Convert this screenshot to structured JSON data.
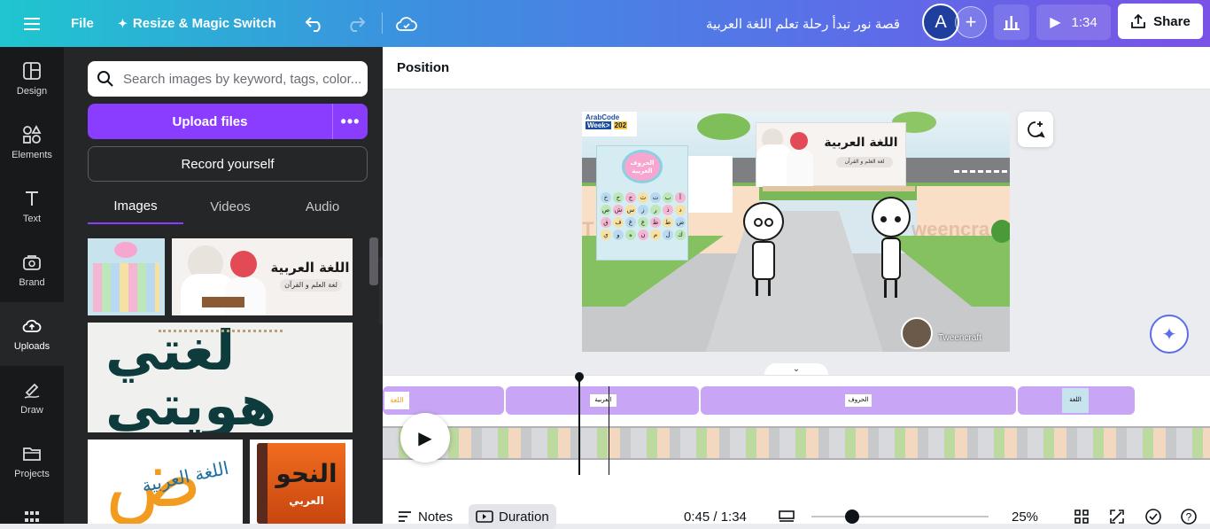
{
  "topbar": {
    "file_label": "File",
    "resize_label": "Resize & Magic Switch",
    "doc_title": "قصة نور تبدأ رحلة تعلم اللغة العربية",
    "avatar_letter": "A",
    "play_duration": "1:34",
    "share_label": "Share"
  },
  "sidebar": {
    "items": [
      {
        "label": "Design",
        "icon": "design-icon"
      },
      {
        "label": "Elements",
        "icon": "elements-icon"
      },
      {
        "label": "Text",
        "icon": "text-icon"
      },
      {
        "label": "Brand",
        "icon": "brand-icon"
      },
      {
        "label": "Uploads",
        "icon": "uploads-icon"
      },
      {
        "label": "Draw",
        "icon": "draw-icon"
      },
      {
        "label": "Projects",
        "icon": "projects-icon"
      }
    ]
  },
  "panel": {
    "search_placeholder": "Search images by keyword, tags, color...",
    "upload_label": "Upload files",
    "more_label": "•••",
    "record_label": "Record yourself",
    "tabs": [
      "Images",
      "Videos",
      "Audio"
    ],
    "thumbs": {
      "calligraphy_1": "لغتي هويتي",
      "arabic_lang_tag": "اللغة العربية",
      "arabic_lang_sub": "لغة العلم و القرآن",
      "dad_logo": "ض",
      "dad_logo_text": "اللغة العربية",
      "nahw_title": "النحو",
      "nahw_sub": "العربي"
    }
  },
  "context_bar": {
    "position_label": "Position"
  },
  "slide": {
    "badge_line1": "ArabCode",
    "badge_line2": "Week>",
    "badge_line3": "202",
    "poster_title": "الحروف العربية",
    "poster_title_line1": "الحروف",
    "poster_title_line2": "العربية",
    "letters": [
      "أ",
      "ب",
      "ت",
      "ث",
      "ج",
      "ح",
      "خ",
      "د",
      "ذ",
      "ر",
      "ز",
      "س",
      "ش",
      "ص",
      "ض",
      "ط",
      "ظ",
      "ع",
      "غ",
      "ف",
      "ق",
      "ك",
      "ل",
      "م",
      "ن",
      "ه",
      "و",
      "ي"
    ],
    "billboard_title": "اللغة العربية",
    "billboard_sub": "لغة العلم و القرآن",
    "watermark": "Tweencraft",
    "watermark_left": "T",
    "watermark_right": "weencra",
    "credit": "Tweencraft"
  },
  "timeline": {
    "time_display": "0:45 / 1:34",
    "zoom": "25%",
    "notes_label": "Notes",
    "duration_label": "Duration",
    "clip_labels": [
      "اللغة",
      "العربية",
      "الحروف",
      "اللغة"
    ]
  },
  "colors": {
    "accent": "#8b3dff",
    "clip": "#c9a6f5",
    "sidebar_bg": "#18191b",
    "panel_bg": "#252627"
  }
}
